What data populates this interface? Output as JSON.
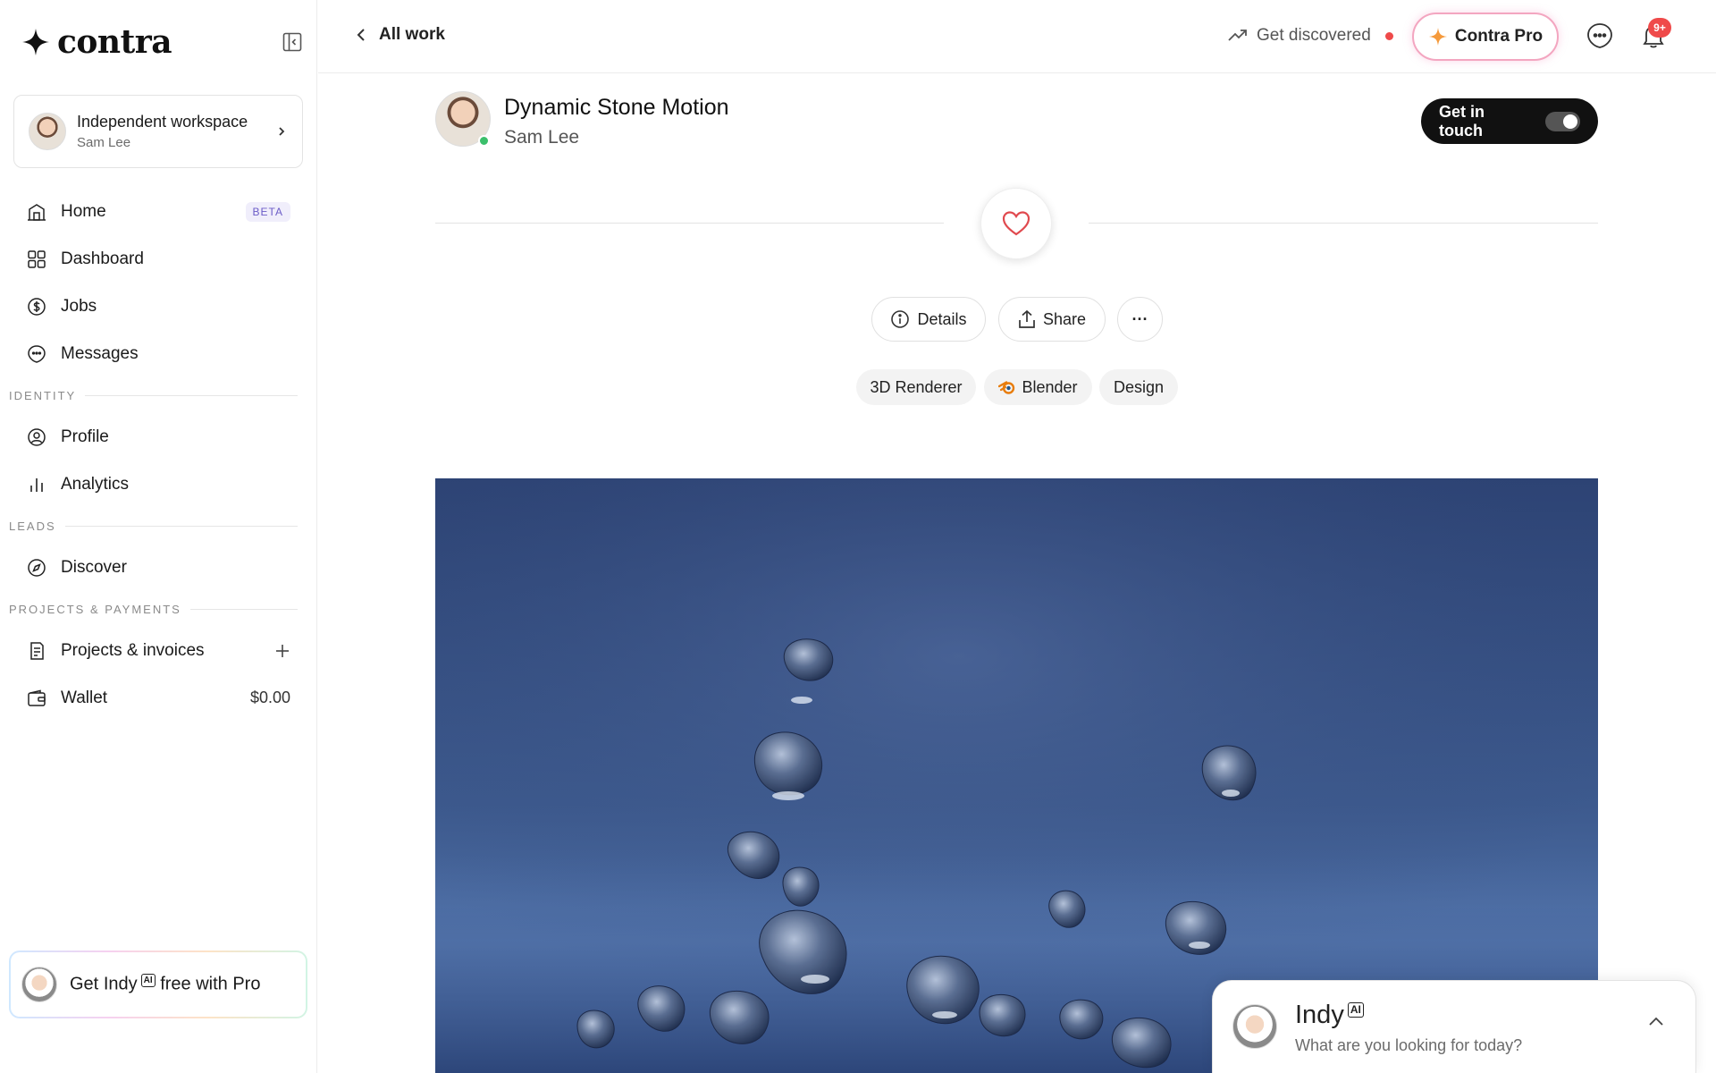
{
  "brand": {
    "name": "contra"
  },
  "workspace": {
    "name": "Independent workspace",
    "user": "Sam Lee"
  },
  "nav": {
    "home": {
      "label": "Home",
      "badge": "BETA"
    },
    "dashboard": {
      "label": "Dashboard"
    },
    "jobs": {
      "label": "Jobs"
    },
    "messages": {
      "label": "Messages"
    },
    "section_identity": "IDENTITY",
    "profile": {
      "label": "Profile"
    },
    "analytics": {
      "label": "Analytics"
    },
    "section_leads": "LEADS",
    "discover": {
      "label": "Discover"
    },
    "section_projects": "PROJECTS & PAYMENTS",
    "projects": {
      "label": "Projects & invoices"
    },
    "wallet": {
      "label": "Wallet",
      "value": "$0.00"
    }
  },
  "indy_promo": {
    "prefix": "Get",
    "name": "Indy",
    "ai": "AI",
    "suffix": "free with Pro"
  },
  "topbar": {
    "back_label": "All work",
    "get_discovered": "Get discovered",
    "pro_label": "Contra Pro",
    "notifications_badge": "9+"
  },
  "project": {
    "title": "Dynamic Stone Motion",
    "author": "Sam Lee",
    "get_in_touch": "Get in touch",
    "actions": {
      "details": "Details",
      "share": "Share",
      "more": "···"
    },
    "tags": [
      "3D Renderer",
      "Blender",
      "Design"
    ]
  },
  "indy_chat": {
    "name": "Indy",
    "ai": "AI",
    "prompt": "What are you looking for today?"
  },
  "colors": {
    "accent_red": "#ef4a4a",
    "online": "#3bbf6b",
    "hero_bg": "#3d5a8e",
    "pro_border": "#f3a6c0"
  }
}
